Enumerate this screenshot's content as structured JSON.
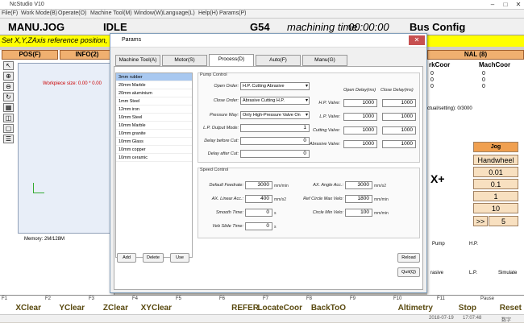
{
  "app": {
    "title": "NcStudio V10"
  },
  "menu": [
    "File(F)",
    "Work Mode(B)",
    "Operate(O)",
    "Machine Tool(M)",
    "Window(W)",
    "Language(L)",
    "Help(H)",
    "Params(P)"
  ],
  "status": {
    "mode": "MANU.JOG",
    "state": "IDLE",
    "coord": "G54",
    "machining_time_label": "machining time",
    "machining_time": "00:00:00",
    "config": "Bus Config"
  },
  "info": "Set X,Y,ZAxis reference position, th",
  "left": {
    "tab1": "POS(F)",
    "tab2": "INFO(2)",
    "workpiece": "Workpiece size: 0.00 * 0.00",
    "memory": "Memory: 2M/128M"
  },
  "right": {
    "tab": "NAL (8)",
    "workcoor": "rkCoor",
    "machcoor": "MachCoor",
    "vals": [
      "0",
      "0",
      "0",
      "0",
      "0",
      "0"
    ],
    "actual": "ctual/setting): 0/3000",
    "xplus": "X+"
  },
  "jog": {
    "label": "Jog",
    "mode": "Handwheel",
    "steps": [
      "0.01",
      "0.1",
      "1",
      "10"
    ],
    "speed_prefix": ">>",
    "speed": "5"
  },
  "side_buttons": {
    "pump": "Pump",
    "hp": "H.P.",
    "rasive": "rasive",
    "lp": "L.P.",
    "simulate": "Simulate"
  },
  "dialog": {
    "title": "Params",
    "tabs": [
      "Machine Tool(A)",
      "Motor(S)",
      "Process(D)",
      "Auto(F)",
      "Manu(G)"
    ],
    "materials": [
      "3mm rubber",
      "20mm Marble",
      "20mm aluminium",
      "1mm Steel",
      "12mm iron",
      "10mm Steel",
      "10mm Marble",
      "10mm granite",
      "10mm Glass",
      "10mm copper",
      "10mm ceramic"
    ],
    "pump_control": "Pump Control",
    "open_order_label": "Open Order:",
    "open_order": "H.P. Cutting Abrasive",
    "close_order_label": "Close Order:",
    "close_order": "Abrasive Cutting H.P.",
    "pressure_way_label": "Pressure Way:",
    "pressure_way": "Only High-Pressure Valve On",
    "lp_output_label": "L.P. Output Mode:",
    "lp_output": "1",
    "delay_before_label": "Delay before Cut:",
    "delay_before": "0",
    "delay_after_label": "Delay after Cut:",
    "delay_after": "0",
    "open_delay_label": "Open Delay(ms)",
    "close_delay_label": "Close Delay(ms)",
    "valves": [
      {
        "label": "H.P. Valve:",
        "open": "1000",
        "close": "1000"
      },
      {
        "label": "L.P. Valve:",
        "open": "1000",
        "close": "1000"
      },
      {
        "label": "Cutting Valve:",
        "open": "1000",
        "close": "1000"
      },
      {
        "label": "Abrasive Valve:",
        "open": "1000",
        "close": "1000"
      }
    ],
    "speed_control": "Speed Control",
    "default_feedrate_label": "Default Feedrate:",
    "default_feedrate": "3000",
    "mm_min": "mm/min",
    "ax_linear_label": "AX. Linear Acc.:",
    "ax_linear": "400",
    "mm_s2": "mm/s2",
    "smooth_label": "Smooth Time:",
    "smooth": "0",
    "s": "s",
    "veb_label": "Veb Slide Time:",
    "veb": "0",
    "ax_angle_label": "AX. Angle Acc.:",
    "ax_angle": "3000",
    "ref_circle_label": "Ref Circle Max Velo:",
    "ref_circle": "1800",
    "circle_min_label": "Circle Min Velo:",
    "circle_min": "100",
    "add": "Add",
    "delete": "Delete",
    "use": "Use",
    "reload": "Reload",
    "quit": "Quit(Q)"
  },
  "fkeys": [
    {
      "k": "F1",
      "v": "XClear"
    },
    {
      "k": "F2",
      "v": "YClear"
    },
    {
      "k": "F3",
      "v": "ZClear"
    },
    {
      "k": "F4",
      "v": "XYClear"
    },
    {
      "k": "F5",
      "v": ""
    },
    {
      "k": "F6",
      "v": "REFER"
    },
    {
      "k": "F7",
      "v": "LocateCoor"
    },
    {
      "k": "F8",
      "v": "BackToO"
    },
    {
      "k": "F9",
      "v": ""
    },
    {
      "k": "F10",
      "v": "Altimetry"
    },
    {
      "k": "F11",
      "v": "Stop"
    },
    {
      "k": "Pause",
      "v": "Reset"
    }
  ],
  "statusbar": {
    "date": "2018-07-19",
    "time": "17:07:48",
    "ime": "数字"
  }
}
